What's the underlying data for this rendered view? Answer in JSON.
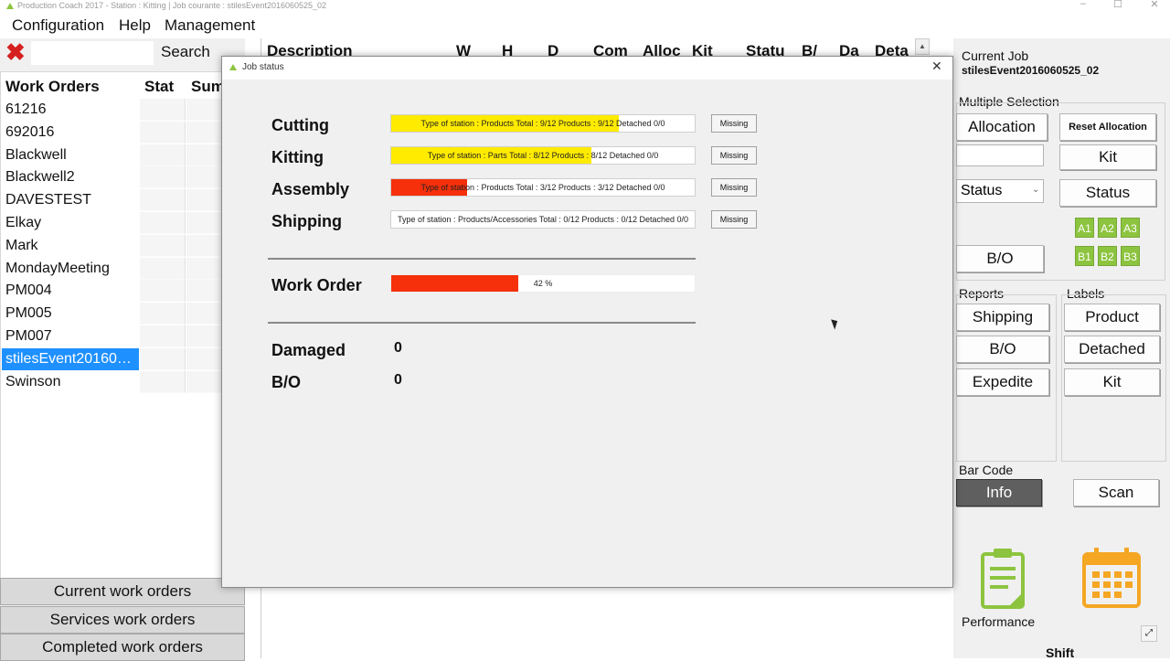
{
  "window": {
    "title": "Production Coach 2017 - Station : Kitting | Job courante : stilesEvent2016060525_02",
    "minimize": "–",
    "maximize": "☐",
    "close": "✕"
  },
  "menu": {
    "items": [
      "Configuration",
      "Help",
      "Management"
    ]
  },
  "left": {
    "search_label": "Search",
    "search_value": "",
    "headers": [
      "Work Orders",
      "Stat",
      "Sum"
    ],
    "rows": [
      "61216",
      "692016",
      "Blackwell",
      "Blackwell2",
      "DAVESTEST",
      "Elkay",
      "Mark",
      "MondayMeeting",
      "PM004",
      "PM005",
      "PM007",
      "stilesEvent20160…",
      "Swinson"
    ],
    "selected_index": 11,
    "bottom_buttons": [
      "Current work orders",
      "Services work orders",
      "Completed work orders"
    ]
  },
  "center": {
    "columns": [
      "Description",
      "W",
      "H",
      "D",
      "Com",
      "Alloc",
      "Kit",
      "Statu",
      "B/",
      "Da",
      "Deta"
    ]
  },
  "right": {
    "current_job_label": "Current Job",
    "current_job_value": "stilesEvent2016060525_02",
    "multiple_selection_label": "Multiple Selection",
    "allocation": "Allocation",
    "reset_allocation": "Reset Allocation",
    "alloc_input": "",
    "kit": "Kit",
    "status_select": "Status",
    "status": "Status",
    "badges": [
      "A1",
      "A2",
      "A3",
      "B1",
      "B2",
      "B3"
    ],
    "bo": "B/O",
    "reports_label": "Reports",
    "labels_label": "Labels",
    "reports": [
      "Shipping",
      "B/O",
      "Expedite"
    ],
    "labels": [
      "Product",
      "Detached",
      "Kit"
    ],
    "barcode_label": "Bar Code",
    "info": "Info",
    "scan": "Scan",
    "performance_label": "Performance",
    "shift_label": "Shift",
    "colors": {
      "icon_green": "#8dc43f",
      "icon_orange": "#f5a623",
      "info_bg": "#5f5f5f"
    }
  },
  "dialog": {
    "title": "Job status",
    "close": "✕",
    "stages": [
      {
        "label": "Cutting",
        "text": "Type of station : Products   Total : 9/12   Products : 9/12   Detached 0/0",
        "progress": 0.75,
        "color": "#ffeb00",
        "missing": "Missing"
      },
      {
        "label": "Kitting",
        "text": "Type of station : Parts   Total : 8/12   Products : 8/12   Detached 0/0",
        "progress": 0.66,
        "color": "#ffeb00",
        "missing": "Missing"
      },
      {
        "label": "Assembly",
        "text": "Type of station : Products   Total : 3/12   Products : 3/12   Detached 0/0",
        "progress": 0.25,
        "color": "#f5300a",
        "missing": "Missing"
      },
      {
        "label": "Shipping",
        "text": "Type of station : Products/Accessories   Total : 0/12   Products : 0/12   Detached 0/0",
        "progress": 0,
        "color": "#f5300a",
        "missing": "Missing"
      }
    ],
    "work_order_label": "Work Order",
    "work_order_text": "42 %",
    "work_order_progress": 0.42,
    "work_order_color": "#f5300a",
    "damaged_label": "Damaged",
    "damaged_value": "0",
    "bo_label": "B/O",
    "bo_value": "0"
  }
}
